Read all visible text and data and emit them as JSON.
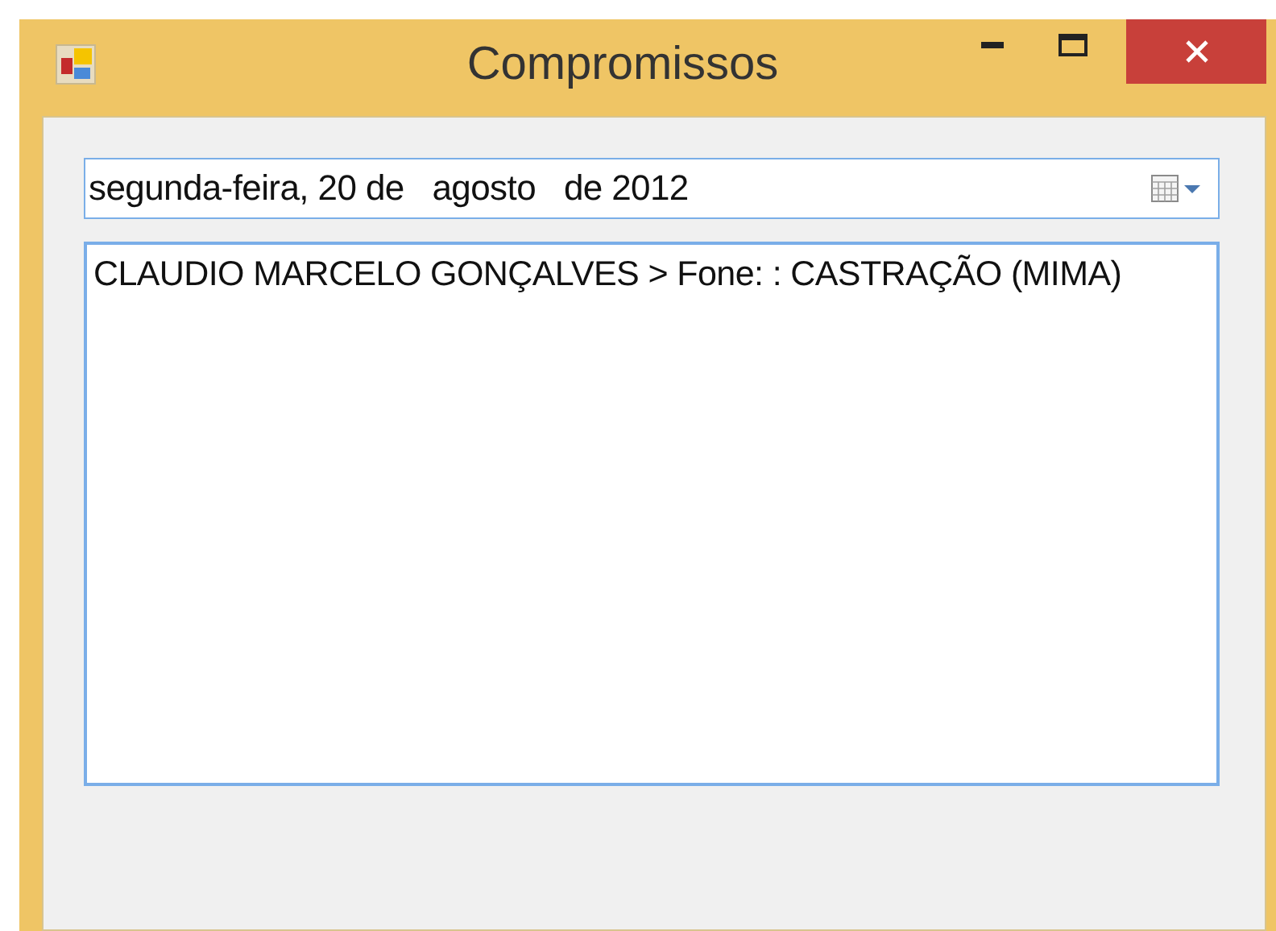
{
  "window": {
    "title": "Compromissos"
  },
  "date_picker": {
    "value": "segunda-feira, 20 de   agosto   de 2012"
  },
  "list": {
    "items": [
      {
        "text": "CLAUDIO MARCELO GONÇALVES >  Fone: : CASTRAÇÃO (MIMA)",
        "selected": false
      }
    ]
  }
}
